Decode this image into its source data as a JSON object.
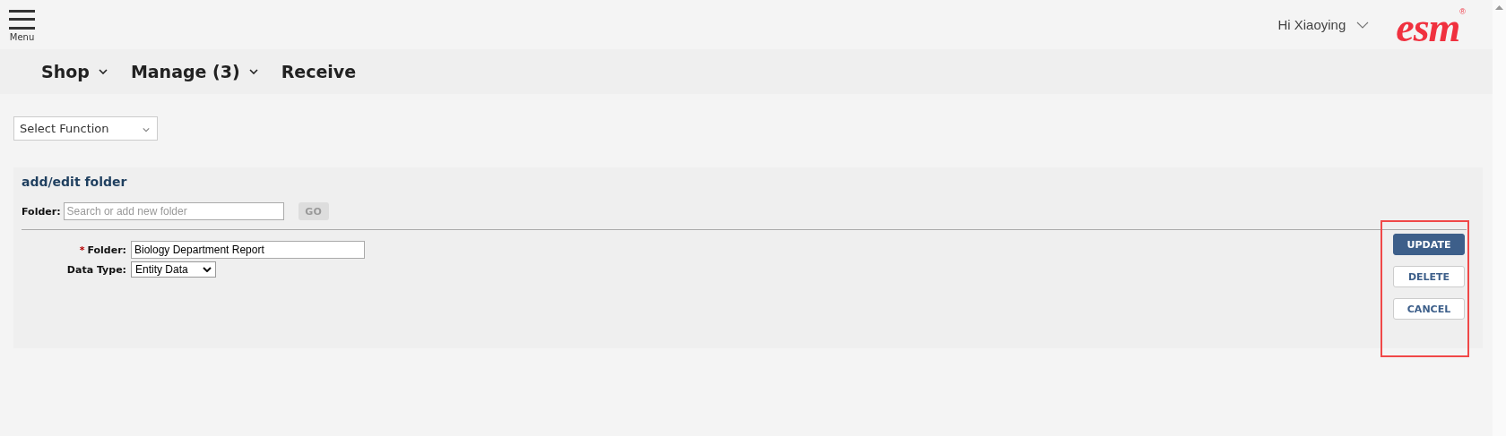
{
  "header": {
    "menu_label": "Menu",
    "greeting": "Hi Xiaoying",
    "logo": "esm",
    "logo_mark": "®"
  },
  "nav": [
    {
      "label": "Shop",
      "dropdown": true
    },
    {
      "label": "Manage (3)",
      "dropdown": true
    },
    {
      "label": "Receive",
      "dropdown": false
    }
  ],
  "function_select": {
    "value": "Select Function"
  },
  "panel": {
    "title": "add/edit folder",
    "search": {
      "label": "Folder:",
      "placeholder": "Search or add new folder",
      "button": "GO",
      "disabled": true
    },
    "fields": [
      {
        "kind": "text",
        "required_mark": "*",
        "label": "Folder:",
        "value": "Biology Department Report"
      },
      {
        "kind": "select",
        "label": "Data Type:",
        "value": "Entity Data"
      }
    ],
    "actions": [
      {
        "label": "UPDATE",
        "kind": "primary"
      },
      {
        "label": "DELETE",
        "kind": "secondary"
      },
      {
        "label": "CANCEL",
        "kind": "secondary"
      }
    ]
  }
}
